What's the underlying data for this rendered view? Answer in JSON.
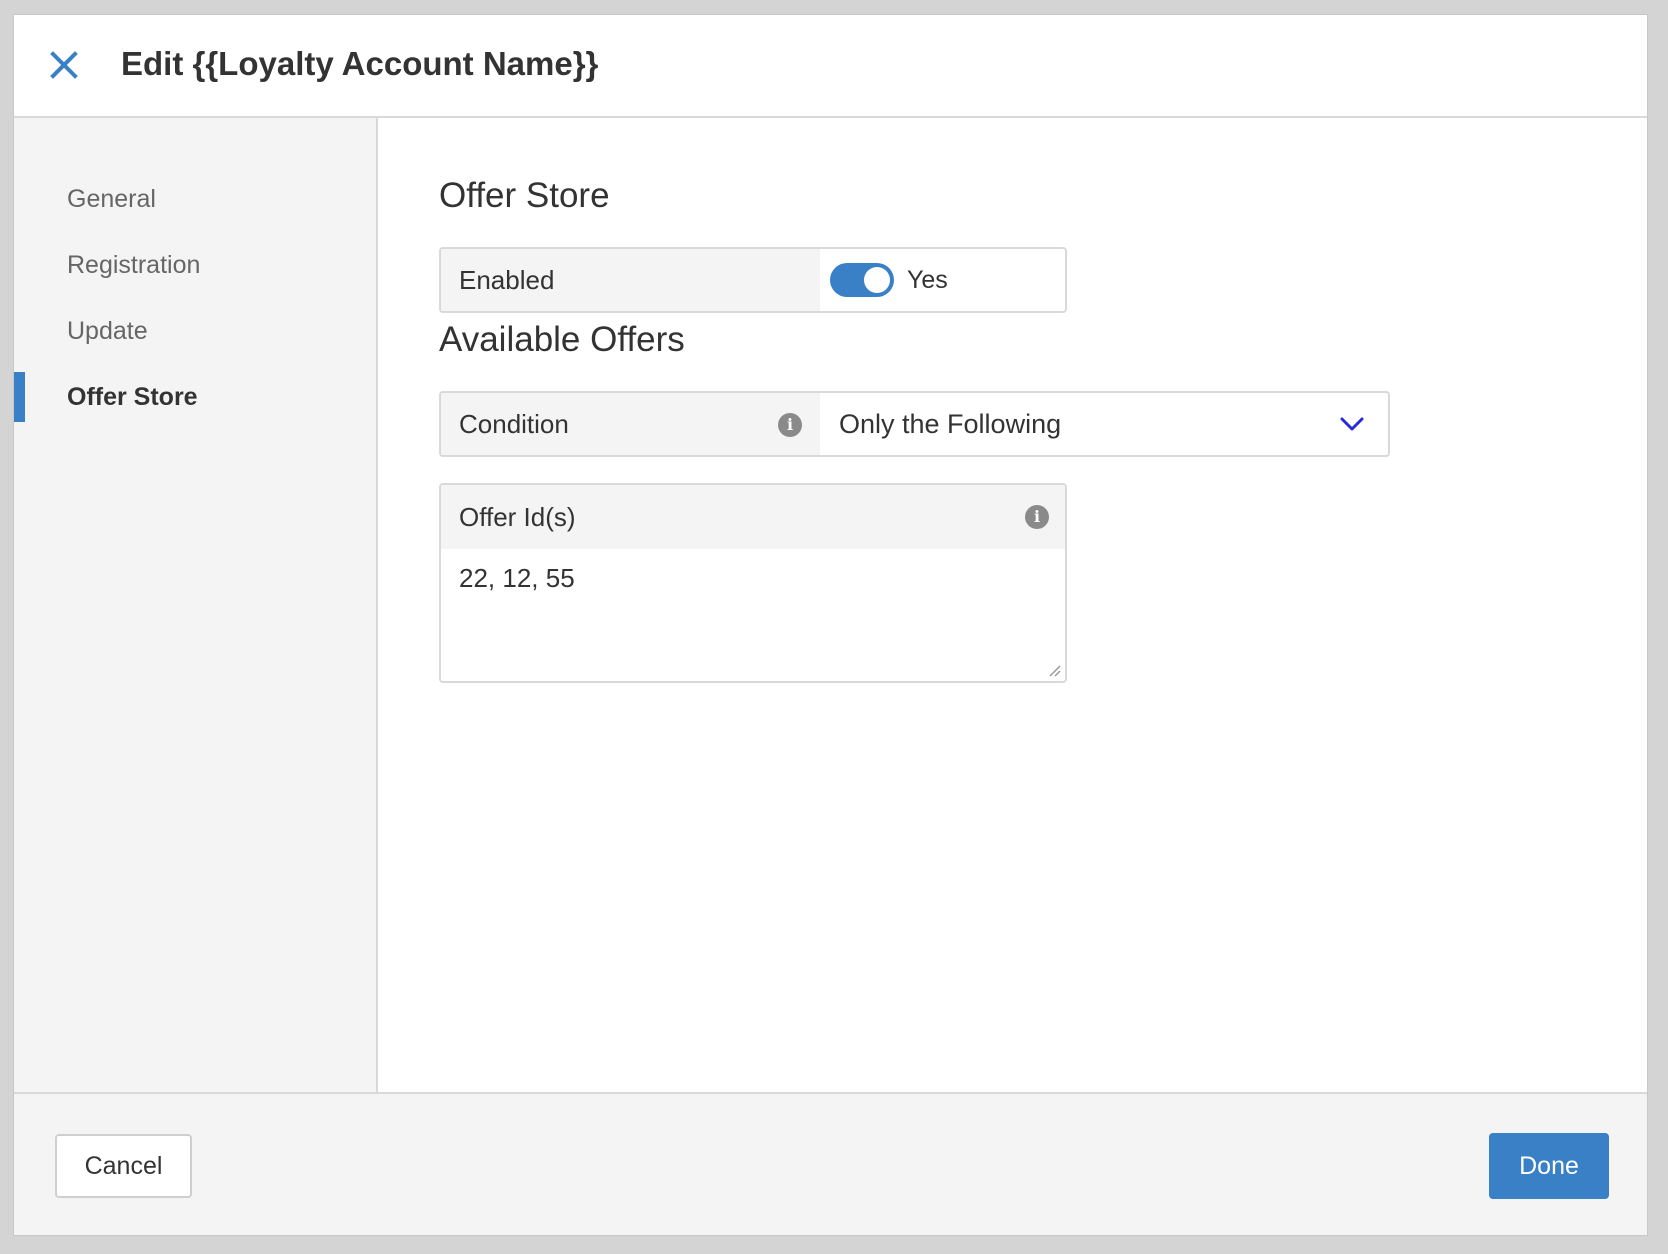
{
  "header": {
    "title": "Edit {{Loyalty Account Name}}",
    "close_icon": "close-icon"
  },
  "sidebar": {
    "items": [
      {
        "label": "General",
        "active": false
      },
      {
        "label": "Registration",
        "active": false
      },
      {
        "label": "Update",
        "active": false
      },
      {
        "label": "Offer Store",
        "active": true
      }
    ]
  },
  "main": {
    "offer_store": {
      "title": "Offer Store",
      "enabled_label": "Enabled",
      "enabled_value": "Yes",
      "enabled": true
    },
    "available_offers": {
      "title": "Available Offers",
      "condition_label": "Condition",
      "condition_value": "Only the Following",
      "offer_ids_label": "Offer Id(s)",
      "offer_ids_value": "22, 12, 55"
    }
  },
  "footer": {
    "cancel_label": "Cancel",
    "done_label": "Done"
  },
  "colors": {
    "accent": "#3a80c6",
    "chevron": "#2a2ad6",
    "background": "#d4d4d4",
    "panel": "#f4f4f4"
  }
}
